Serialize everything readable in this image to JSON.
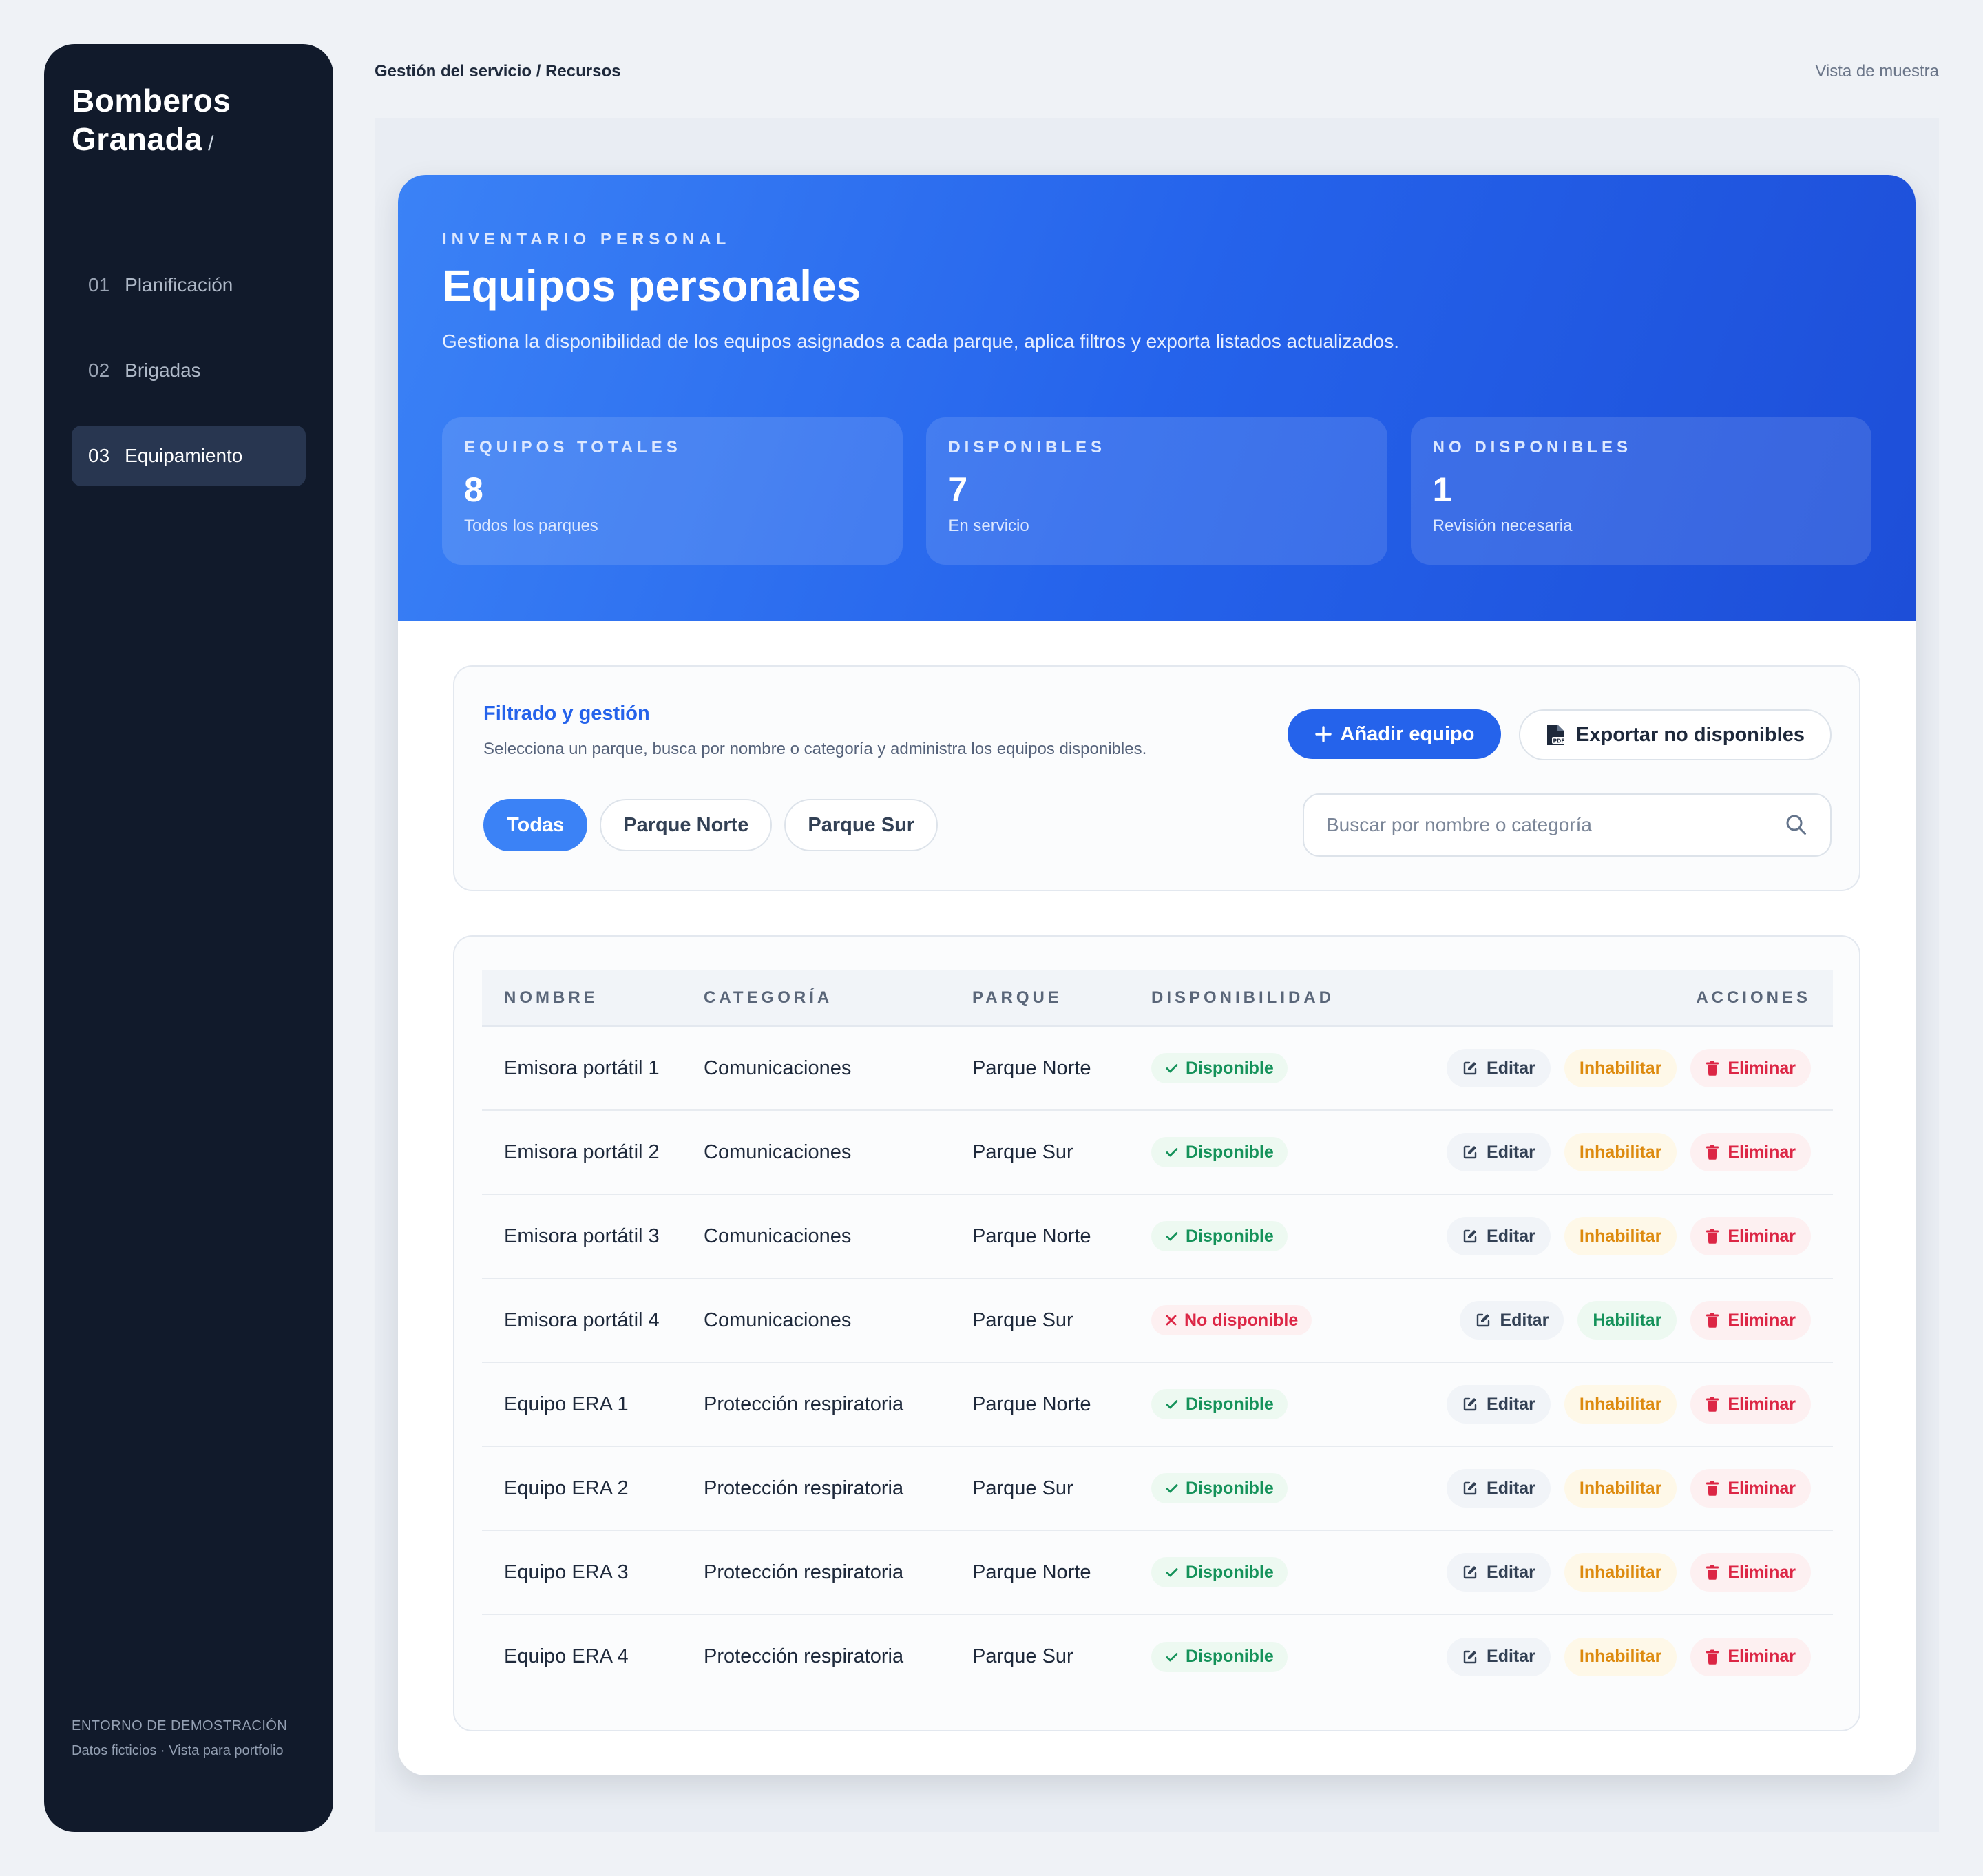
{
  "sidebar": {
    "brand_line1": "Bomberos",
    "brand_line2": "Granada",
    "brand_slash": "/",
    "items": [
      {
        "num": "01",
        "label": "Planificación",
        "active": false
      },
      {
        "num": "02",
        "label": "Brigadas",
        "active": false
      },
      {
        "num": "03",
        "label": "Equipamiento",
        "active": true
      }
    ],
    "footer": {
      "env": "Entorno de demostración",
      "note": "Datos ficticios · Vista para portfolio"
    }
  },
  "topbar": {
    "breadcrumb": "Gestión del servicio / Recursos",
    "mode": "Vista de muestra"
  },
  "hero": {
    "eyebrow": "INVENTARIO PERSONAL",
    "title": "Equipos personales",
    "description": "Gestiona la disponibilidad de los equipos asignados a cada parque, aplica filtros y exporta listados actualizados.",
    "stats": [
      {
        "label": "EQUIPOS TOTALES",
        "value": "8",
        "sub": "Todos los parques"
      },
      {
        "label": "DISPONIBLES",
        "value": "7",
        "sub": "En servicio"
      },
      {
        "label": "NO DISPONIBLES",
        "value": "1",
        "sub": "Revisión necesaria"
      }
    ]
  },
  "filters": {
    "title": "Filtrado y gestión",
    "subtitle": "Selecciona un parque, busca por nombre o categoría y administra los equipos disponibles.",
    "add_label": "Añadir equipo",
    "export_label": "Exportar no disponibles",
    "chips": [
      {
        "label": "Todas",
        "active": true
      },
      {
        "label": "Parque Norte",
        "active": false
      },
      {
        "label": "Parque Sur",
        "active": false
      }
    ],
    "search_placeholder": "Buscar por nombre o categoría"
  },
  "table": {
    "headers": {
      "name": "NOMBRE",
      "category": "CATEGORÍA",
      "park": "PARQUE",
      "availability": "DISPONIBILIDAD",
      "actions": "ACCIONES"
    },
    "labels": {
      "available": "Disponible",
      "unavailable": "No disponible",
      "edit": "Editar",
      "disable": "Inhabilitar",
      "enable": "Habilitar",
      "delete": "Eliminar"
    },
    "rows": [
      {
        "name": "Emisora portátil 1",
        "category": "Comunicaciones",
        "park": "Parque Norte",
        "available": true
      },
      {
        "name": "Emisora portátil 2",
        "category": "Comunicaciones",
        "park": "Parque Sur",
        "available": true
      },
      {
        "name": "Emisora portátil 3",
        "category": "Comunicaciones",
        "park": "Parque Norte",
        "available": true
      },
      {
        "name": "Emisora portátil 4",
        "category": "Comunicaciones",
        "park": "Parque Sur",
        "available": false
      },
      {
        "name": "Equipo ERA 1",
        "category": "Protección respiratoria",
        "park": "Parque Norte",
        "available": true
      },
      {
        "name": "Equipo ERA 2",
        "category": "Protección respiratoria",
        "park": "Parque Sur",
        "available": true
      },
      {
        "name": "Equipo ERA 3",
        "category": "Protección respiratoria",
        "park": "Parque Norte",
        "available": true
      },
      {
        "name": "Equipo ERA 4",
        "category": "Protección respiratoria",
        "park": "Parque Sur",
        "available": true
      }
    ]
  },
  "colors": {
    "primary": "#2563eb",
    "sidebar_bg": "#111a2b",
    "success": "#15925a",
    "danger": "#dc2645",
    "warning": "#dd8a0e"
  },
  "icons": {
    "add": "plus-icon",
    "export": "pdf-file-icon",
    "search": "search-icon",
    "available": "check-icon",
    "unavailable": "x-icon",
    "edit": "edit-icon",
    "delete": "trash-icon"
  }
}
